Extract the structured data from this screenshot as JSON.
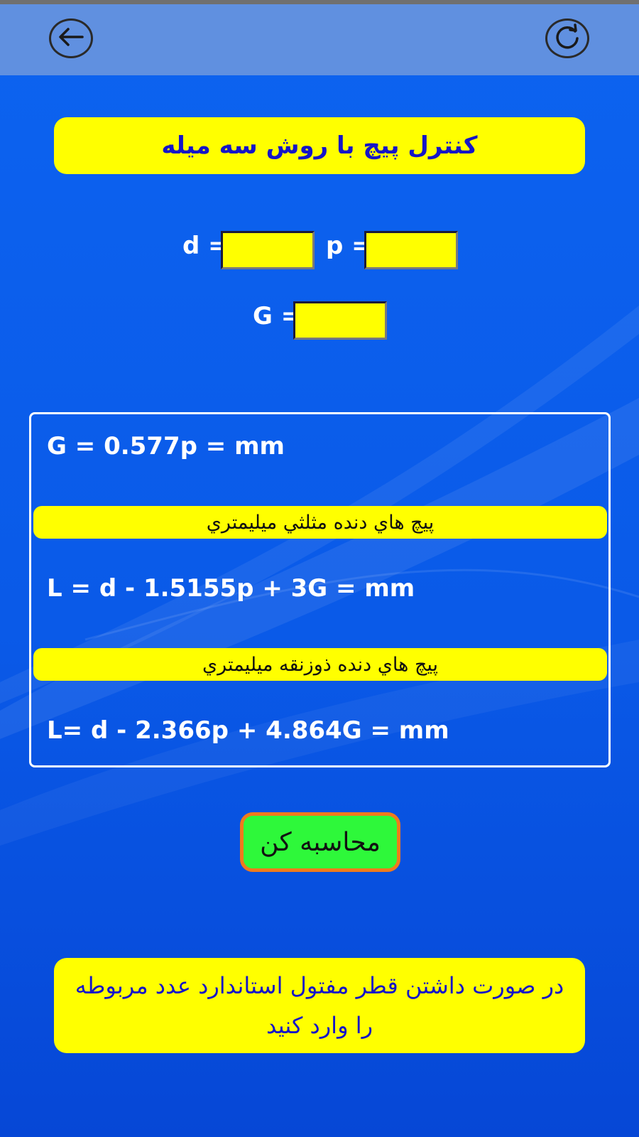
{
  "app_bar": {
    "back_icon": "arrow-left-icon",
    "refresh_icon": "refresh-icon"
  },
  "title": "کنترل پیچ با روش سه میله",
  "inputs": {
    "d_label": "d =",
    "d_value": "",
    "p_label": "p =",
    "p_value": "",
    "g_label": "G =",
    "g_value": ""
  },
  "results": {
    "g_formula": "G = 0.577p = mm",
    "metric_triangular_header": "پیچ هاي دنده مثلثي ميليمتري",
    "l_metric_formula": "L = d - 1.5155p + 3G = mm",
    "metric_trapezoidal_header": "پیچ هاي دنده ذوزنقه ميليمتري",
    "l_trapezoidal_formula": "L= d - 2.366p + 4.864G = mm"
  },
  "calculate_button": "محاسبه کن",
  "note": "در صورت داشتن قطر مفتول استاندارد عدد مربوطه را وارد کنید",
  "colors": {
    "background": "#0a5ae8",
    "app_bar": "#6090e0",
    "highlight": "#ffff00",
    "title_text": "#1515c8",
    "button_fill": "#2ef83a",
    "button_border": "#f07a1c"
  }
}
